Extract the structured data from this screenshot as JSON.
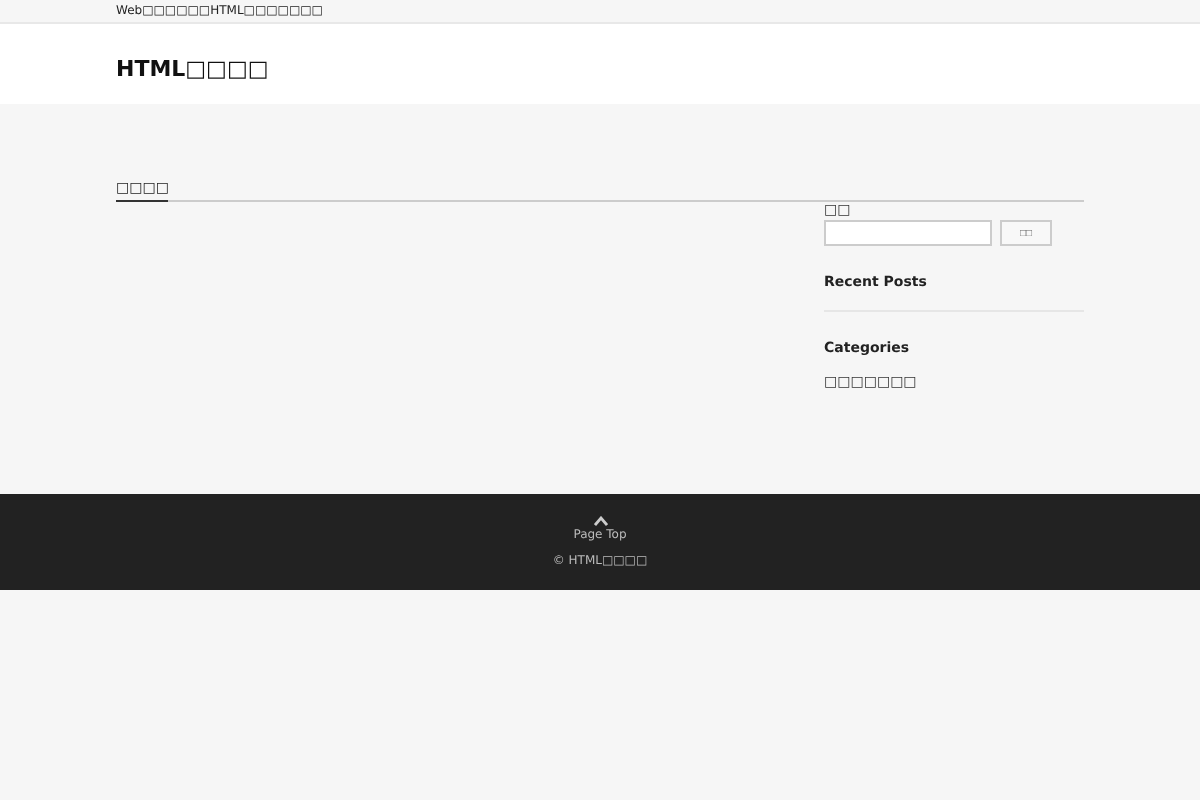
{
  "top_bar": {
    "tagline": "Web□□□□□□HTML□□□□□□□"
  },
  "header": {
    "site_title": "HTML□□□□"
  },
  "main": {
    "heading": "□□□□"
  },
  "sidebar": {
    "search_label": "□□",
    "search_button": "□□",
    "widgets": [
      {
        "kind": "posts",
        "title": "Recent Posts"
      },
      {
        "kind": "categories",
        "title": "Categories",
        "items": [
          "□□□□□□□"
        ]
      }
    ]
  },
  "footer": {
    "page_top": "Page Top",
    "copyright": "© HTML□□□□"
  }
}
